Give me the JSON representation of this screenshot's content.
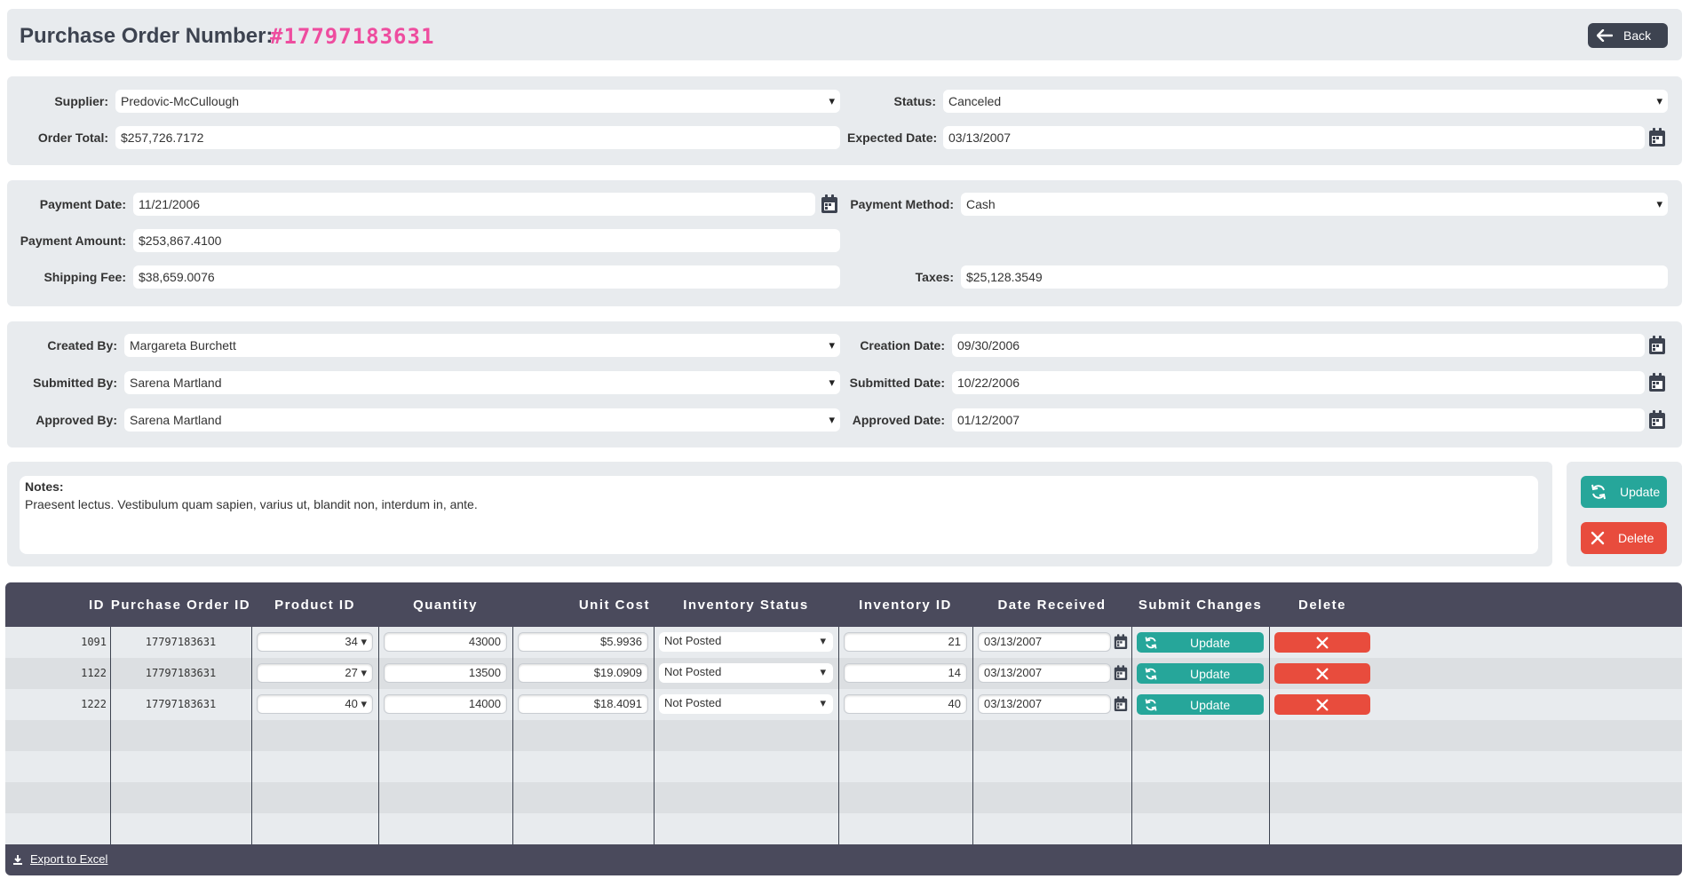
{
  "header": {
    "title": "Purchase Order Number:",
    "po_number": "#17797183631",
    "back_label": "Back"
  },
  "order": {
    "supplier_label": "Supplier:",
    "supplier": "Predovic-McCullough",
    "status_label": "Status:",
    "status": "Canceled",
    "order_total_label": "Order Total:",
    "order_total": "$257,726.7172",
    "expected_date_label": "Expected Date:",
    "expected_date": "03/13/2007"
  },
  "payment": {
    "payment_date_label": "Payment Date:",
    "payment_date": "11/21/2006",
    "payment_method_label": "Payment Method:",
    "payment_method": "Cash",
    "payment_amount_label": "Payment Amount:",
    "payment_amount": "$253,867.4100",
    "shipping_fee_label": "Shipping Fee:",
    "shipping_fee": "$38,659.0076",
    "taxes_label": "Taxes:",
    "taxes": "$25,128.3549"
  },
  "approval": {
    "created_by_label": "Created By:",
    "created_by": "Margareta Burchett",
    "creation_date_label": "Creation Date:",
    "creation_date": "09/30/2006",
    "submitted_by_label": "Submitted By:",
    "submitted_by": "Sarena Martland",
    "submitted_date_label": "Submitted Date:",
    "submitted_date": "10/22/2006",
    "approved_by_label": "Approved By:",
    "approved_by": "Sarena Martland",
    "approved_date_label": "Approved Date:",
    "approved_date": "01/12/2007"
  },
  "notes": {
    "label": "Notes:",
    "text": "Praesent lectus. Vestibulum quam sapien, varius ut, blandit non, interdum in, ante."
  },
  "actions": {
    "update_label": "Update",
    "delete_label": "Delete"
  },
  "table": {
    "columns": [
      "ID",
      "Purchase Order ID",
      "Product ID",
      "Quantity",
      "Unit Cost",
      "Inventory Status",
      "Inventory ID",
      "Date Received",
      "Submit Changes",
      "Delete"
    ],
    "rows": [
      {
        "id": "1091",
        "po_id": "17797183631",
        "product_id": "34",
        "quantity": "43000",
        "unit_cost": "$5.9936",
        "inventory_status": "Not Posted",
        "inventory_id": "21",
        "date_received": "03/13/2007",
        "update_label": "Update"
      },
      {
        "id": "1122",
        "po_id": "17797183631",
        "product_id": "27",
        "quantity": "13500",
        "unit_cost": "$19.0909",
        "inventory_status": "Not Posted",
        "inventory_id": "14",
        "date_received": "03/13/2007",
        "update_label": "Update"
      },
      {
        "id": "1222",
        "po_id": "17797183631",
        "product_id": "40",
        "quantity": "14000",
        "unit_cost": "$18.4091",
        "inventory_status": "Not Posted",
        "inventory_id": "40",
        "date_received": "03/13/2007",
        "update_label": "Update"
      }
    ],
    "export_label": "Export to Excel"
  },
  "colors": {
    "accent_pink": "#ee4d9f",
    "dark": "#4a4a5c",
    "teal": "#26a69a",
    "red": "#e84c3d"
  }
}
